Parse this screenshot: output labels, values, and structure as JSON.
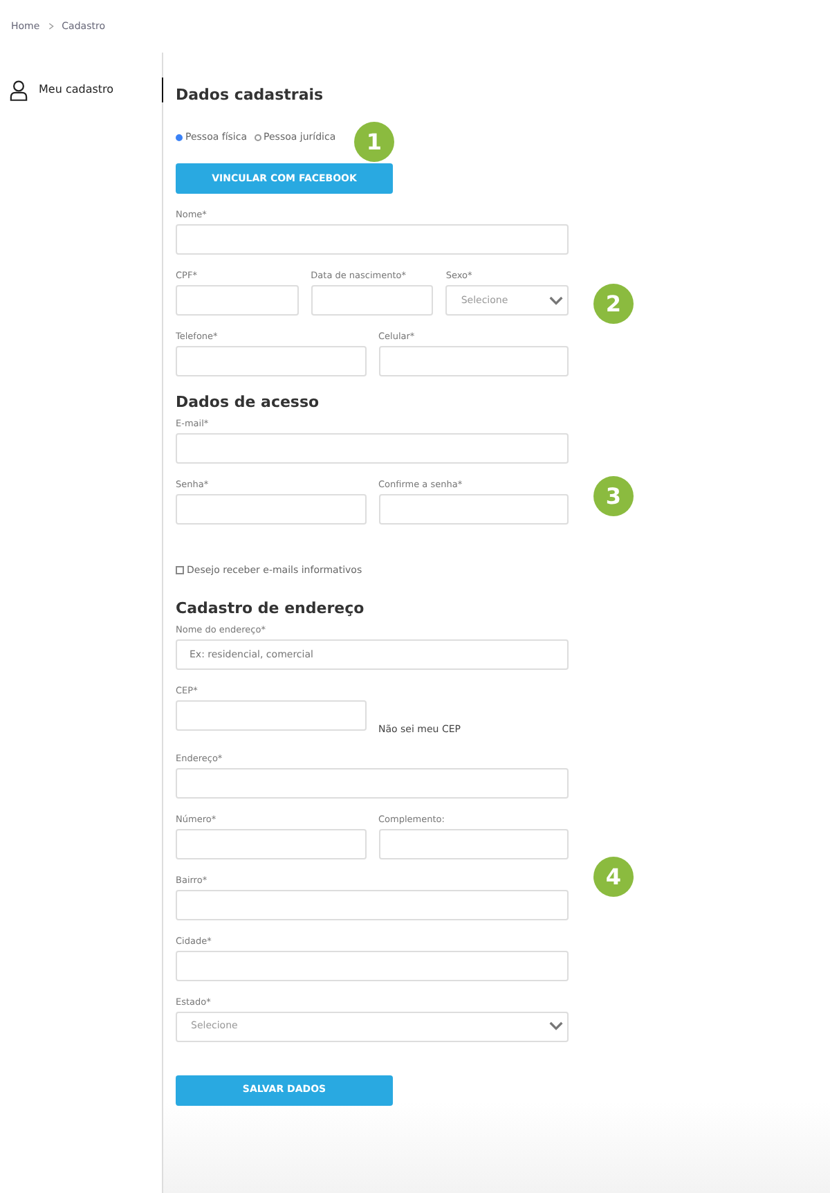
{
  "breadcrumb": [
    {
      "label": "Home"
    },
    {
      "label": "Cadastro"
    }
  ],
  "sidebar": {
    "items": [
      {
        "label": "Meu cadastro",
        "selected": true
      }
    ]
  },
  "sections": [
    {
      "title": "Dados cadastrais",
      "rows": [
        {
          "kind": "radio",
          "options": [
            {
              "label": "Pessoa física",
              "selected": true
            },
            {
              "label": "Pessoa jurídica",
              "selected": false
            }
          ]
        },
        {
          "kind": "button",
          "label": "VINCULAR COM FACEBOOK"
        },
        {
          "kind": "fields",
          "fields": [
            {
              "label": "Nome*",
              "kind": "input"
            }
          ]
        },
        {
          "kind": "fields",
          "fields": [
            {
              "label": "CPF*",
              "kind": "input"
            },
            {
              "label": "Data de nascimento*",
              "kind": "input"
            },
            {
              "label": "Sexo*",
              "kind": "select",
              "placeholder": "Selecione"
            }
          ]
        },
        {
          "kind": "fields",
          "fields": [
            {
              "label": "Telefone*",
              "kind": "input"
            },
            {
              "label": "Celular*",
              "kind": "input"
            }
          ]
        }
      ]
    },
    {
      "title": "Dados de acesso",
      "rows": [
        {
          "kind": "fields",
          "fields": [
            {
              "label": "E-mail*",
              "kind": "input"
            }
          ]
        },
        {
          "kind": "fields",
          "fields": [
            {
              "label": "Senha*",
              "kind": "input"
            },
            {
              "label": "Confirme a senha*",
              "kind": "input"
            }
          ]
        },
        {
          "kind": "checkbox",
          "label": "Desejo receber e-mails informativos",
          "checked": false
        }
      ]
    },
    {
      "title": "Cadastro de endereço",
      "rows": [
        {
          "kind": "fields",
          "fields": [
            {
              "label": "Nome do endereço*",
              "kind": "input",
              "placeholder": "Ex: residencial, comercial"
            }
          ]
        },
        {
          "kind": "fields",
          "fields": [
            {
              "label": "CEP*",
              "kind": "input"
            },
            {
              "label": "Não sei meu CEP",
              "kind": "link"
            }
          ]
        },
        {
          "kind": "fields",
          "fields": [
            {
              "label": "Endereço*",
              "kind": "input"
            }
          ]
        },
        {
          "kind": "fields",
          "fields": [
            {
              "label": "Número*",
              "kind": "input"
            },
            {
              "label": "Complemento:",
              "kind": "input"
            }
          ]
        },
        {
          "kind": "fields",
          "fields": [
            {
              "label": "Bairro*",
              "kind": "input"
            }
          ]
        },
        {
          "kind": "fields",
          "fields": [
            {
              "label": "Cidade*",
              "kind": "input"
            }
          ]
        },
        {
          "kind": "fields",
          "fields": [
            {
              "label": "Estado*",
              "kind": "select",
              "placeholder": "Selecione"
            }
          ]
        },
        {
          "kind": "button",
          "label": "SALVAR DADOS"
        }
      ]
    }
  ],
  "badges": [
    {
      "label": "1"
    },
    {
      "label": "2"
    },
    {
      "label": "3"
    },
    {
      "label": "4"
    }
  ]
}
